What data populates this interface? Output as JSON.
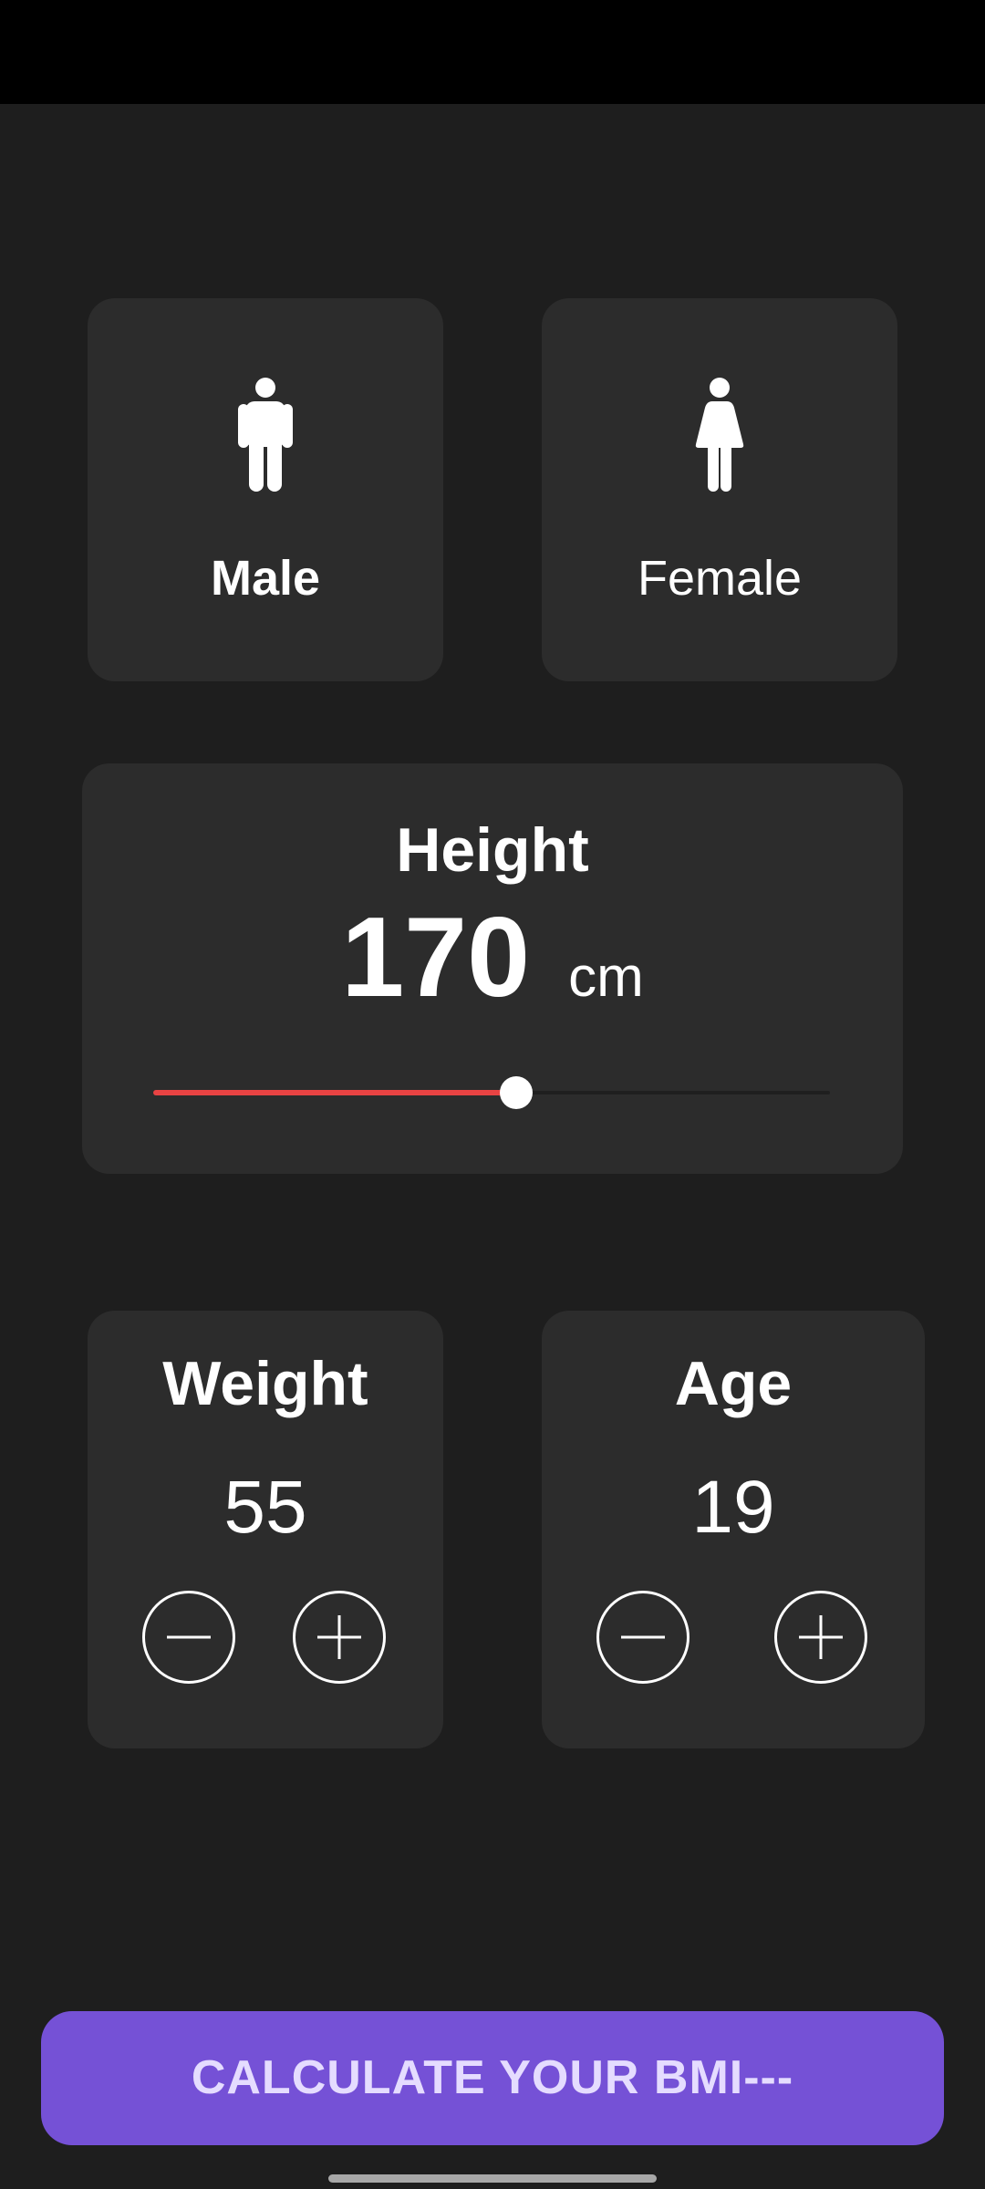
{
  "gender": {
    "male_label": "Male",
    "female_label": "Female",
    "selected": "male"
  },
  "height": {
    "title": "Height",
    "value": "170",
    "unit": "cm",
    "slider_fraction": 0.536,
    "fill_color": "#e84343"
  },
  "weight": {
    "title": "Weight",
    "value": "55"
  },
  "age": {
    "title": "Age",
    "value": "19"
  },
  "action": {
    "calculate_label": "CALCULATE YOUR BMI---",
    "color": "#7551d6"
  },
  "icons": {
    "male": "male-figure-icon",
    "female": "female-figure-icon",
    "minus": "minus-circle-icon",
    "plus": "plus-circle-icon"
  },
  "colors": {
    "background": "#1e1e1e",
    "card": "#2c2c2c"
  }
}
